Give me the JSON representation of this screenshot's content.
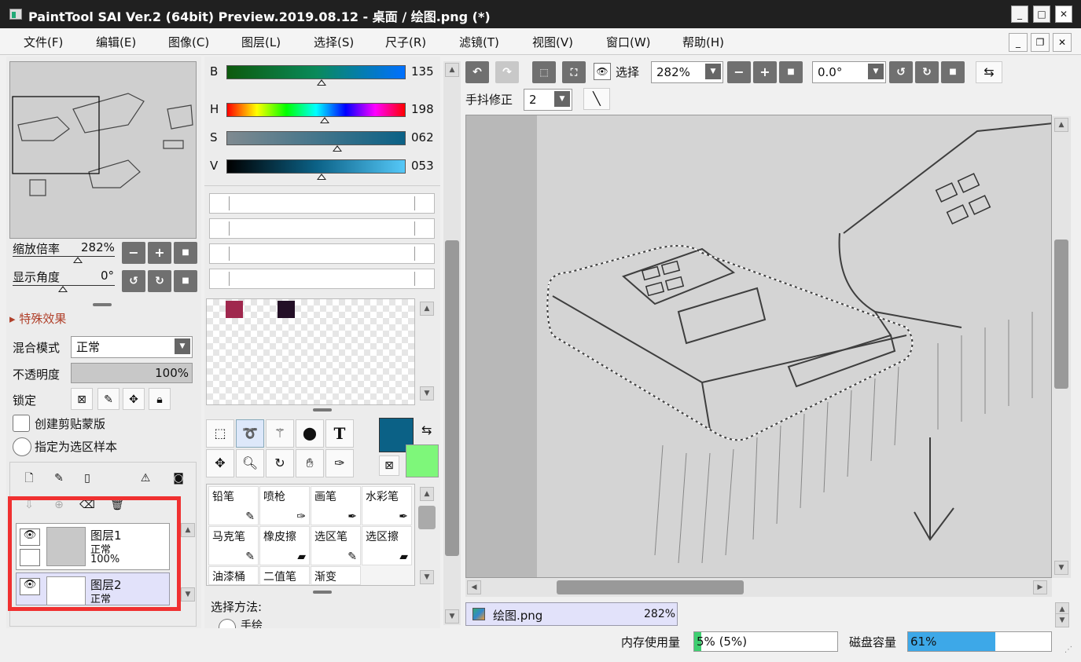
{
  "window": {
    "title": "PaintTool SAI Ver.2 (64bit) Preview.2019.08.12 - 桌面 / 绘图.png (*)",
    "minimize": "_",
    "maximize": "□",
    "close": "✕"
  },
  "menu": [
    "文件(F)",
    "编辑(E)",
    "图像(C)",
    "图层(L)",
    "选择(S)",
    "尺子(R)",
    "滤镜(T)",
    "视图(V)",
    "窗口(W)",
    "帮助(H)"
  ],
  "navigator": {
    "zoom_label": "缩放倍率",
    "zoom_value": "282%",
    "angle_label": "显示角度",
    "angle_value": "0°"
  },
  "layer_panel": {
    "effects_label": "特殊效果",
    "blend_label": "混合模式",
    "blend_value": "正常",
    "opacity_label": "不透明度",
    "opacity_value": "100%",
    "opacity_fraction": 1.0,
    "lock_label": "锁定",
    "clip_label": "创建剪贴蒙版",
    "sample_label": "指定为选区样本",
    "layers": [
      {
        "name": "图层1",
        "mode": "正常",
        "opacity": "100%"
      },
      {
        "name": "图层2",
        "mode": "正常"
      }
    ]
  },
  "color": {
    "channels": [
      {
        "label": "B",
        "value": "135",
        "fraction": 0.53
      },
      {
        "label": "H",
        "value": "198",
        "fraction": 0.55
      },
      {
        "label": "S",
        "value": "062",
        "fraction": 0.62
      },
      {
        "label": "V",
        "value": "053",
        "fraction": 0.53
      }
    ],
    "swatches": [
      "#a0284e",
      "#230f26"
    ],
    "primary": "#0b6186",
    "secondary": "#7ef77a"
  },
  "tools": {
    "text_icon": "T"
  },
  "brushes": [
    "铅笔",
    "喷枪",
    "画笔",
    "水彩笔",
    "马克笔",
    "橡皮擦",
    "选区笔",
    "选区擦",
    "油漆桶",
    "二值笔",
    "渐变"
  ],
  "selection_method": {
    "label": "选择方法:",
    "option": "手绘"
  },
  "toolbar": {
    "select_label": "选择",
    "zoom": "282%",
    "angle": "0.0°",
    "stabilizer_label": "手抖修正",
    "stabilizer": "2"
  },
  "tab": {
    "name": "绘图.png",
    "zoom": "282%"
  },
  "status": {
    "memory_label": "内存使用量",
    "memory_value": "5% (5%)",
    "memory_fraction": 0.05,
    "disk_label": "磁盘容量",
    "disk_value": "61%",
    "disk_fraction": 0.61
  },
  "colors": {
    "accent": "#3da8e8",
    "highlight": "#f03030"
  }
}
